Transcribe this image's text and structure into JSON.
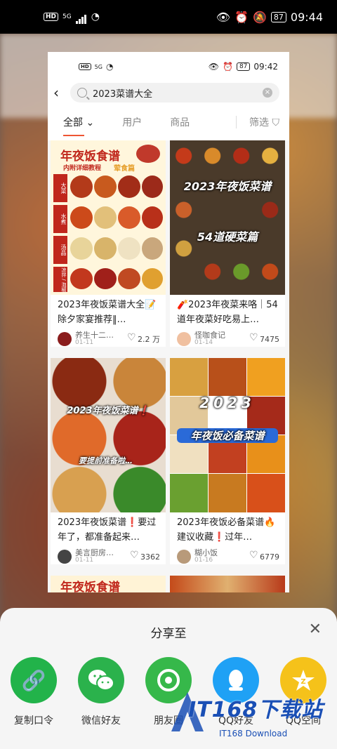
{
  "status_bar": {
    "hd": "HD",
    "signal": "5G",
    "battery": "87",
    "time": "09:44"
  },
  "inner_status_bar": {
    "hd": "HD",
    "signal": "5G",
    "battery": "87",
    "time": "09:42"
  },
  "search": {
    "query": "2023菜谱大全"
  },
  "tabs": {
    "all": "全部",
    "users": "用户",
    "products": "商品",
    "filter": "筛选"
  },
  "posts": [
    {
      "title": "2023年夜饭菜谱大全📝除夕家宴推荐‖…",
      "author": "养生十二…",
      "date": "01-11",
      "likes": "2.2 万",
      "image_heading": "年夜饭食谱",
      "image_sub": "内附详细教程",
      "image_tag": "荤食篇",
      "image_rows": [
        "大菜",
        "水煮",
        "汤品",
        "凉拌 / 泡椒"
      ]
    },
    {
      "title": "🧨2023年夜菜来咯｜54道年夜菜好吃易上…",
      "author": "怪咖食记",
      "date": "01-14",
      "likes": "7475",
      "image_heading": "2023年夜饭菜谱",
      "image_sub": "54道硬菜篇"
    },
    {
      "title": "2023年夜饭菜谱❗要过年了，都准备起来…",
      "author": "美言厨房…",
      "date": "01-11",
      "likes": "3362",
      "image_heading": "2023年夜饭菜谱❗",
      "image_sub": "要提前准备啦…"
    },
    {
      "title": "2023年夜饭必备菜谱🔥建议收藏❗过年…",
      "author": "糊小饭",
      "date": "01-16",
      "likes": "6779",
      "image_heading": "2023",
      "image_sub": "年夜饭必备菜谱"
    }
  ],
  "partial_next": "年夜饭食谱",
  "share_sheet": {
    "title": "分享至",
    "items": [
      {
        "label": "复制口令",
        "icon": "link-icon",
        "color": "#22b34a"
      },
      {
        "label": "微信好友",
        "icon": "wechat-icon",
        "color": "#2bb24c"
      },
      {
        "label": "朋友圈",
        "icon": "moments-icon",
        "color": "#36b84a"
      },
      {
        "label": "QQ好友",
        "icon": "qq-icon",
        "color": "#1fa1f5"
      },
      {
        "label": "QQ空间",
        "icon": "qzone-icon",
        "color": "#f5c21a"
      }
    ]
  },
  "watermark": {
    "main": "IT168下载站",
    "sub": "IT168 Download"
  }
}
